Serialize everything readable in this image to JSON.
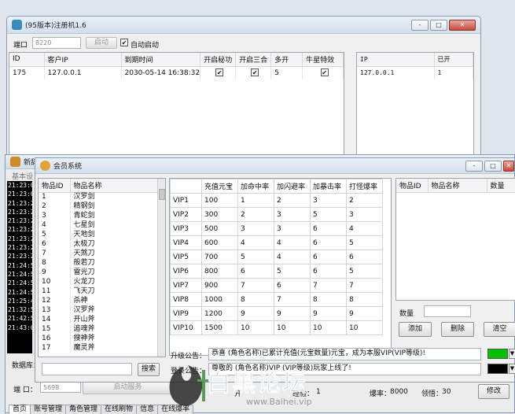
{
  "main_window": {
    "title": "(95版本)注册机1.6",
    "title_buttons": [
      "-",
      "□",
      "✕"
    ],
    "port_label": "端口",
    "port_value": "8220",
    "start_button": "启动",
    "autostart_label": "自动启动",
    "clients": {
      "columns": [
        "ID",
        "客户IP",
        "到期时间",
        "开启秘功",
        "开启三合",
        "多开",
        "牛星特效"
      ],
      "rows": [
        {
          "id": "175",
          "ip": "127.0.0.1",
          "expire": "2030-05-14 16:38:32",
          "mi": true,
          "sanhe": true,
          "duokai": "5",
          "niuxing": true
        }
      ]
    },
    "ip_list": {
      "columns": [
        "IP",
        "已开"
      ],
      "rows": [
        [
          "127.0.0.1",
          "1"
        ]
      ]
    }
  },
  "back_window": {
    "title": "新辞",
    "subtitle": "基本设",
    "console_lines": [
      "21:23:0",
      "21:23:0",
      "21:23:2",
      "21:23:2",
      "21:23:2",
      "21:23:2",
      "21:23:2",
      "21:23:2",
      "21:23:2",
      "21:24:5",
      "21:24:5",
      "21:24:5",
      "21:24:5",
      "21:25:4",
      "21:32:5",
      "21:42:5",
      "21:43:0"
    ],
    "db_label": "数据库：",
    "port_label": "端  口：",
    "port_value": "5698",
    "start_service": "启动服务",
    "vip_label": "开",
    "level_label": "等级",
    "tabs": [
      "首页",
      "账号管理",
      "角色管理",
      "在线刷物",
      "信息",
      "在线爆率"
    ]
  },
  "member_window": {
    "title": "会员系统",
    "items": {
      "columns": [
        "物品ID",
        "物品名称"
      ],
      "rows": [
        [
          "1",
          "汉罗剑"
        ],
        [
          "2",
          "精钢剑"
        ],
        [
          "3",
          "青蛇剑"
        ],
        [
          "4",
          "七星剑"
        ],
        [
          "5",
          "天地剑"
        ],
        [
          "6",
          "太极刀"
        ],
        [
          "7",
          "天煞刀"
        ],
        [
          "8",
          "般若刀"
        ],
        [
          "9",
          "雷光刀"
        ],
        [
          "10",
          "火龙刀"
        ],
        [
          "11",
          "飞天刀"
        ],
        [
          "12",
          "杀神"
        ],
        [
          "13",
          "汉罗斧"
        ],
        [
          "14",
          "开山斧"
        ],
        [
          "15",
          "追魂斧"
        ],
        [
          "16",
          "搜神斧"
        ],
        [
          "17",
          "魔灵斧"
        ]
      ],
      "search_button": "搜索"
    },
    "vip": {
      "columns": [
        "",
        "充值元宝",
        "加命中率",
        "加闪避率",
        "加暴击率",
        "打怪爆率"
      ],
      "rows": [
        [
          "VIP1",
          "100",
          "1",
          "2",
          "3",
          "2"
        ],
        [
          "VIP2",
          "300",
          "2",
          "3",
          "5",
          "3"
        ],
        [
          "VIP3",
          "500",
          "3",
          "3",
          "6",
          "4"
        ],
        [
          "VIP4",
          "600",
          "4",
          "4",
          "6",
          "5"
        ],
        [
          "VIP5",
          "700",
          "5",
          "4",
          "6",
          "6"
        ],
        [
          "VIP6",
          "800",
          "6",
          "5",
          "6",
          "5"
        ],
        [
          "VIP7",
          "900",
          "7",
          "6",
          "7",
          "7"
        ],
        [
          "VIP8",
          "1000",
          "8",
          "7",
          "8",
          "8"
        ],
        [
          "VIP9",
          "1200",
          "9",
          "9",
          "9",
          "9"
        ],
        [
          "VIP10",
          "1500",
          "10",
          "10",
          "10",
          "10"
        ]
      ]
    },
    "reward": {
      "columns": [
        "物品ID",
        "物品名称",
        "数量"
      ],
      "qty_label": "数量",
      "add": "添加",
      "delete": "删除",
      "clear": "清空"
    },
    "announce1_label": "升级公告：",
    "announce1": "恭喜 (角色名称)已累计充值(元宝数量)元宝，成为本服VIP(VIP等级)!",
    "announce2_label": "登录公告：",
    "announce2_text": "尊敬的 (角色名称)VIP (VIP等级)玩家上线了!",
    "bottom_fields": {
      "exp_label": "经验：",
      "exp_value": "1",
      "burst_label": "爆率：",
      "burst_value": "8000",
      "insight_label": "领悟：",
      "insight_value": "30",
      "modify_button": "修改"
    },
    "colors": {
      "announce1": "#00c000",
      "announce2": "#000000"
    }
  },
  "watermark": {
    "brand": "白黑论坛",
    "url": "www.Baihei.vip"
  }
}
